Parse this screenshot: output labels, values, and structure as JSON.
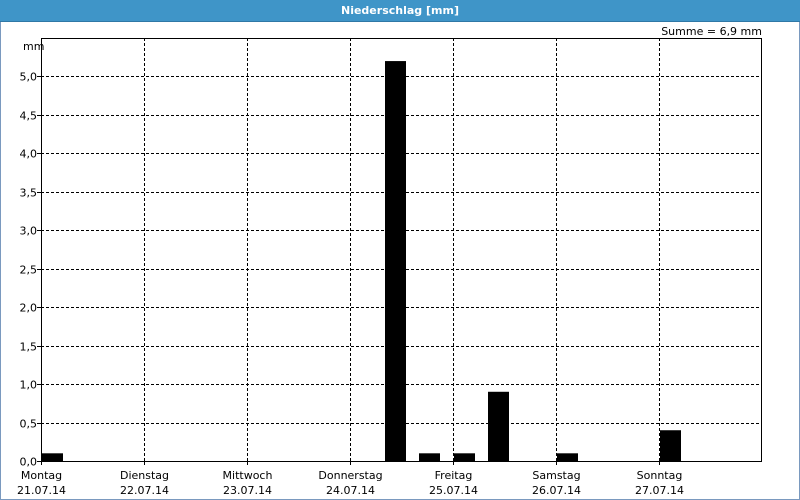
{
  "window": {
    "title": "Niederschlag [mm]"
  },
  "chart_data": {
    "type": "bar",
    "ylabel": "mm",
    "ylim": [
      0,
      5.5
    ],
    "yticks": [
      0,
      0.5,
      1.0,
      1.5,
      2.0,
      2.5,
      3.0,
      3.5,
      4.0,
      4.5,
      5.0
    ],
    "ytick_labels": [
      "0,0",
      "0,5",
      "1,0",
      "1,5",
      "2,0",
      "2,5",
      "3,0",
      "3,5",
      "4,0",
      "4,5",
      "5,0"
    ],
    "grid": true,
    "annotation": "Summe = 6,9 mm",
    "days": [
      {
        "day": "Montag",
        "date": "21.07.14"
      },
      {
        "day": "Dienstag",
        "date": "22.07.14"
      },
      {
        "day": "Mittwoch",
        "date": "23.07.14"
      },
      {
        "day": "Donnerstag",
        "date": "24.07.14"
      },
      {
        "day": "Freitag",
        "date": "25.07.14"
      },
      {
        "day": "Samstag",
        "date": "26.07.14"
      },
      {
        "day": "Sonntag",
        "date": "27.07.14"
      }
    ],
    "bars": [
      {
        "day_index": 0,
        "slot": 0,
        "value": 0.1
      },
      {
        "day_index": 3,
        "slot": 1,
        "value": 5.2
      },
      {
        "day_index": 3,
        "slot": 2,
        "value": 0.1
      },
      {
        "day_index": 4,
        "slot": 0,
        "value": 0.1
      },
      {
        "day_index": 4,
        "slot": 1,
        "value": 0.9
      },
      {
        "day_index": 5,
        "slot": 0,
        "value": 0.1
      },
      {
        "day_index": 6,
        "slot": 0,
        "value": 0.4
      }
    ],
    "bar_color": "#000000",
    "background_color": "#ffffff",
    "title_bar_color": "#3f95c8"
  }
}
